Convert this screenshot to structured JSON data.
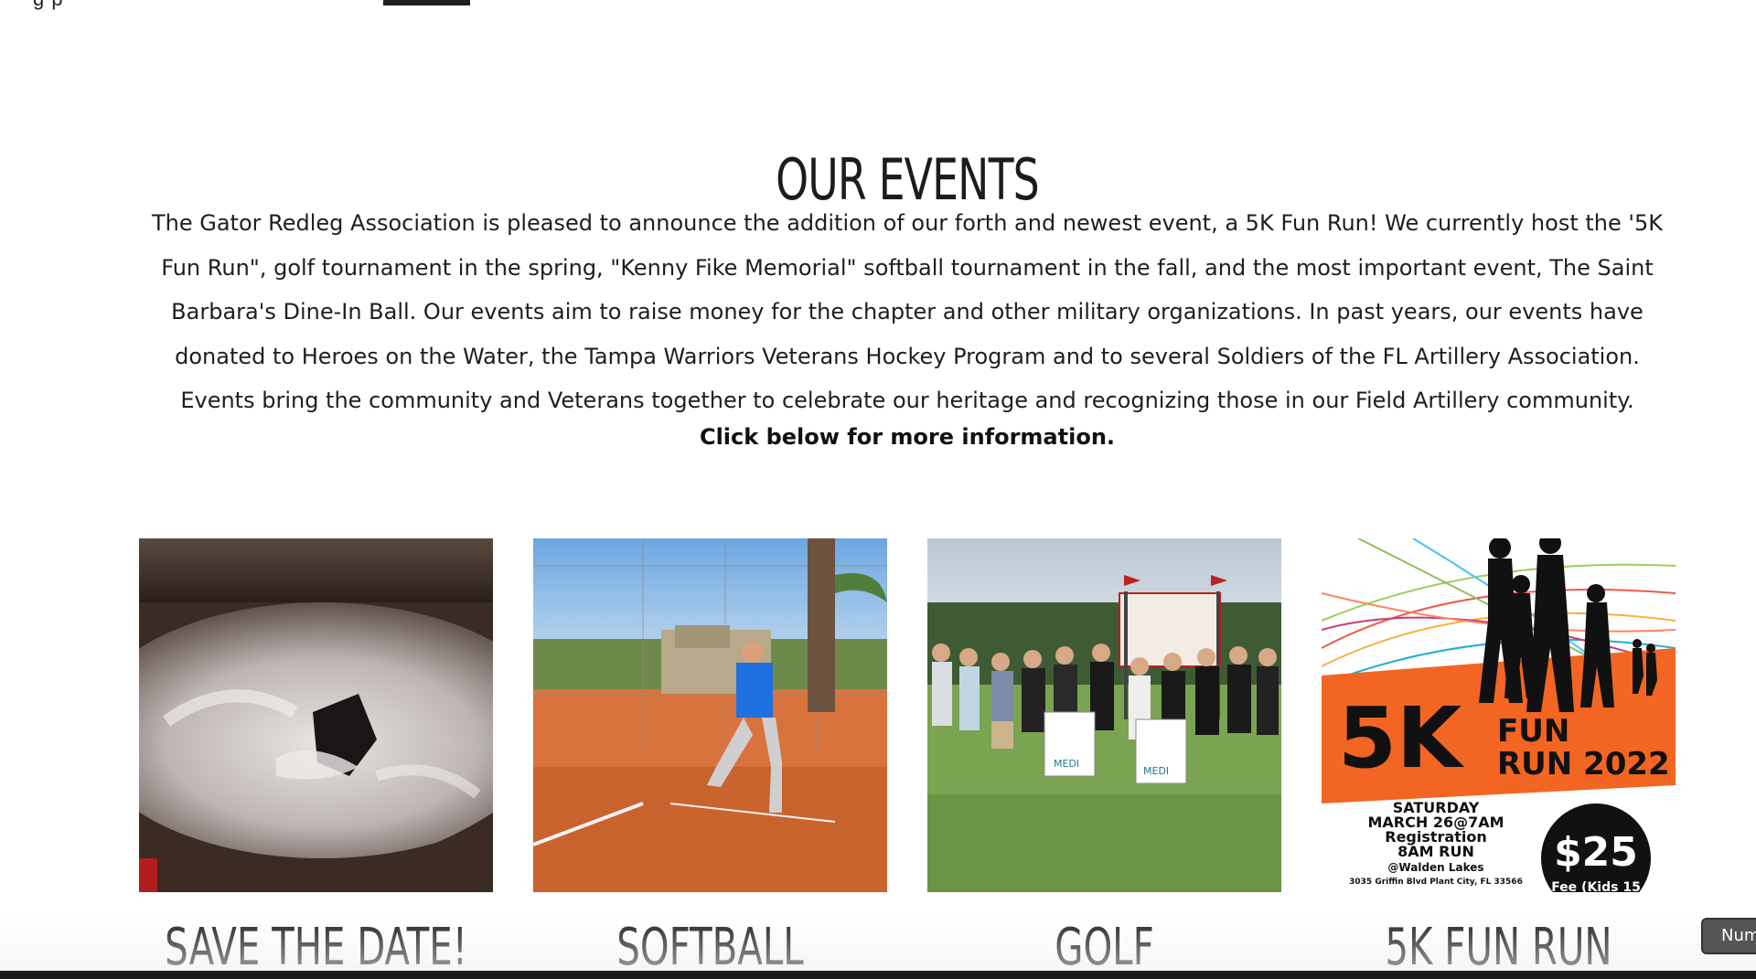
{
  "nav": {
    "fragment": "g   p"
  },
  "section": {
    "title": "OUR EVENTS",
    "intro": "The Gator Redleg Association is pleased to announce the addition of our forth and newest event, a 5K Fun Run!  We currently host the  '5K Fun Run\", golf tournament in the spring, \"Kenny Fike Memorial\" softball tournament in the fall, and the most important event, The Saint Barbara's Dine-In Ball.  Our events aim to raise money for the chapter and other military organizations.  In past years, our events have donated to Heroes on the Water, the Tampa Warriors Veterans Hockey Program and to several Soldiers of the FL Artillery Association.  Events bring the community and Veterans together to celebrate our heritage and recognizing those in our Field Artillery community.",
    "cta": "Click below for more information."
  },
  "events": [
    {
      "title": "SAVE THE DATE!",
      "image": "smoking-bowl-photo"
    },
    {
      "title": "SOFTBALL",
      "image": "softball-pitcher-photo"
    },
    {
      "title": "GOLF",
      "image": "golf-group-photo"
    },
    {
      "title": "5K FUN RUN",
      "image": "5k-fun-run-flyer"
    }
  ],
  "flyer": {
    "headline_big": "5K",
    "headline_fun": "FUN",
    "headline_run": "RUN 2022",
    "date_line1": "SATURDAY",
    "date_line2": "MARCH 26@7AM",
    "date_line3": "Registration",
    "date_line4": "8AM RUN",
    "location": "@Walden Lakes",
    "address": "3035 Griffin Blvd Plant City, FL 33566",
    "price": "$25",
    "price_note": "Fee (Kids 15"
  },
  "golf_sign": {
    "sponsor": "MEDI"
  },
  "badge": {
    "label": "Num"
  },
  "colors": {
    "text": "#1e1e1e",
    "accent_orange": "#f26522",
    "nav_underline": "#1f1f1f"
  }
}
